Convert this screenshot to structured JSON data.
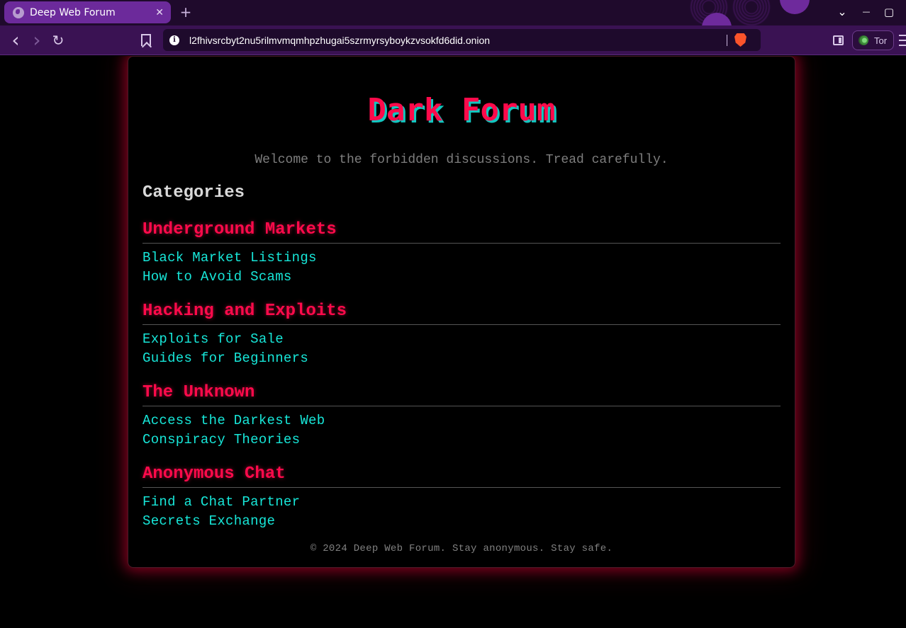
{
  "browser": {
    "tab_title": "Deep Web Forum",
    "tab_close": "✕",
    "new_tab": "+",
    "url": "l2fhivsrcbyt2nu5rilmvmqmhpzhugai5szrmyrsyboykzvsokfd6did.onion",
    "tor_label": "Tor",
    "window_controls": {
      "dropdown": "⌄",
      "minimize": "—",
      "maximize": "▢",
      "close": "✕"
    },
    "nav": {
      "back": "‹",
      "forward": "›",
      "reload": "↻"
    },
    "info_icon": "i"
  },
  "page": {
    "title": "Dark Forum",
    "tagline": "Welcome to the forbidden discussions. Tread carefully.",
    "categories_heading": "Categories",
    "categories": [
      {
        "name": "Underground Markets",
        "links": [
          "Black Market Listings",
          "How to Avoid Scams"
        ]
      },
      {
        "name": "Hacking and Exploits",
        "links": [
          "Exploits for Sale",
          "Guides for Beginners"
        ]
      },
      {
        "name": "The Unknown",
        "links": [
          "Access the Darkest Web",
          "Conspiracy Theories"
        ]
      },
      {
        "name": "Anonymous Chat",
        "links": [
          "Find a Chat Partner",
          "Secrets Exchange"
        ]
      }
    ],
    "footer": "© 2024 Deep Web Forum. Stay anonymous. Stay safe."
  },
  "colors": {
    "accent": "#ff0a4b",
    "link": "#17e6d8",
    "title_shadow": "#13c6c0",
    "browser_frame": "#3a1253",
    "tab_active": "#6c2a9b"
  }
}
